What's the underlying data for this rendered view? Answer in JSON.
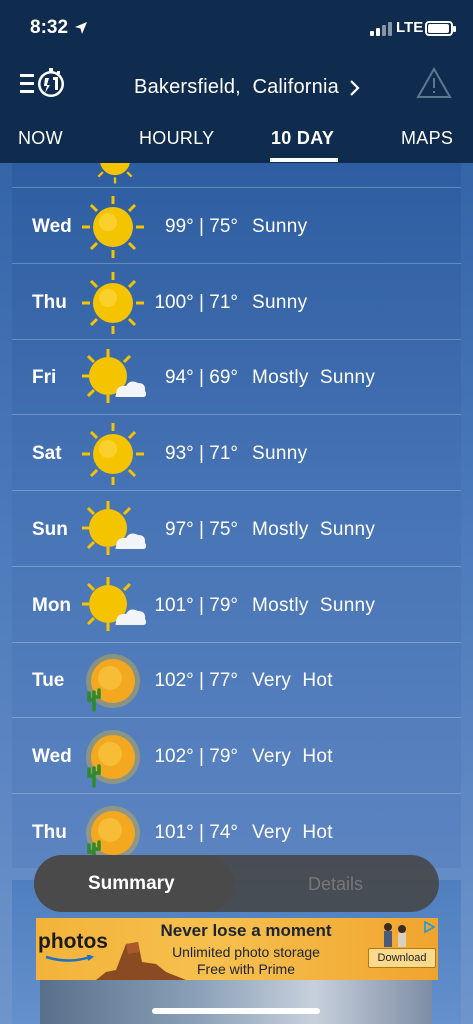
{
  "status_bar": {
    "time": "8:32",
    "network": "LTE"
  },
  "header": {
    "location": "Bakersfield,  California",
    "location_chevron": "›"
  },
  "tabs": [
    {
      "label": "NOW",
      "active": false
    },
    {
      "label": "HOURLY",
      "active": false
    },
    {
      "label": "10 DAY",
      "active": true
    },
    {
      "label": "MAPS",
      "active": false
    }
  ],
  "forecast": [
    {
      "day": "Wed",
      "temps": "99° | 75°",
      "condition": "Sunny",
      "icon": "sun-icon"
    },
    {
      "day": "Thu",
      "temps": "100° | 71°",
      "condition": "Sunny",
      "icon": "sun-icon"
    },
    {
      "day": "Fri",
      "temps": "94° | 69°",
      "condition": "Mostly  Sunny",
      "icon": "sun-cloud-icon"
    },
    {
      "day": "Sat",
      "temps": "93° | 71°",
      "condition": "Sunny",
      "icon": "sun-icon"
    },
    {
      "day": "Sun",
      "temps": "97° | 75°",
      "condition": "Mostly  Sunny",
      "icon": "sun-cloud-icon"
    },
    {
      "day": "Mon",
      "temps": "101° | 79°",
      "condition": "Mostly  Sunny",
      "icon": "sun-cloud-icon"
    },
    {
      "day": "Tue",
      "temps": "102° | 77°",
      "condition": "Very  Hot",
      "icon": "hot-cactus-icon"
    },
    {
      "day": "Wed",
      "temps": "102° | 79°",
      "condition": "Very  Hot",
      "icon": "hot-cactus-icon"
    },
    {
      "day": "Thu",
      "temps": "101° | 74°",
      "condition": "Very  Hot",
      "icon": "hot-cactus-icon"
    }
  ],
  "segment": {
    "summary": "Summary",
    "details": "Details"
  },
  "ad": {
    "brand": "photos",
    "headline": "Never lose a moment",
    "line1": "Unlimited photo storage",
    "line2": "Free with Prime",
    "cta": "Download"
  },
  "colors": {
    "header": "#0f2c4e",
    "accent_sun": "#f5c400"
  }
}
